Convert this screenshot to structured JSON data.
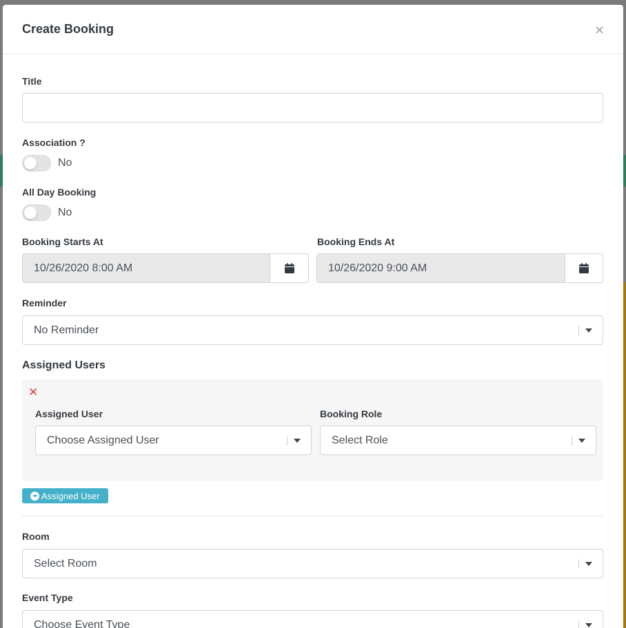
{
  "modal": {
    "title": "Create Booking",
    "close_symbol": "×"
  },
  "form": {
    "title_label": "Title",
    "title_value": "",
    "association_label": "Association ?",
    "association_value": "No",
    "all_day_label": "All Day Booking",
    "all_day_value": "No",
    "starts_label": "Booking Starts At",
    "starts_value": "10/26/2020 8:00 AM",
    "ends_label": "Booking Ends At",
    "ends_value": "10/26/2020 9:00 AM",
    "reminder_label": "Reminder",
    "reminder_value": "No Reminder",
    "assigned_users_label": "Assigned Users",
    "assigned_user_label": "Assigned User",
    "assigned_user_placeholder": "Choose Assigned User",
    "booking_role_label": "Booking Role",
    "booking_role_placeholder": "Select Role",
    "remove_symbol": "✕",
    "add_assigned_user_label": "Assigned User",
    "room_label": "Room",
    "room_placeholder": "Select Room",
    "event_type_label": "Event Type",
    "event_type_placeholder": "Choose Event Type"
  },
  "colors": {
    "accent_button": "#45b0c9",
    "remove_red": "#d9403a"
  },
  "icons": [
    "close-icon",
    "calendar-icon",
    "chevron-down-icon",
    "remove-icon",
    "circle-arrow-left-icon"
  ]
}
